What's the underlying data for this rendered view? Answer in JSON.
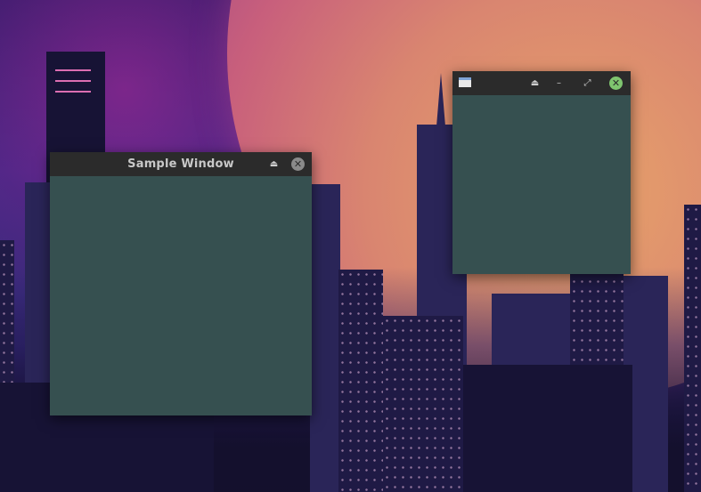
{
  "desktop": {
    "wallpaper": "synthwave-city-night",
    "colors": {
      "sky": "#4b2a8a",
      "sun": "#d98570",
      "buildings": "#1f1a45",
      "window_client": "#365050",
      "titlebar": "#2b2b2b",
      "close_active": "#7fc56f"
    }
  },
  "windows": [
    {
      "title": "Sample Window",
      "buttons": {
        "shade": "⏏",
        "close": "✕"
      }
    },
    {
      "title": "",
      "buttons": {
        "shade": "⏏",
        "minimize": "–",
        "maximize": "⤢",
        "close": "✕"
      }
    }
  ]
}
